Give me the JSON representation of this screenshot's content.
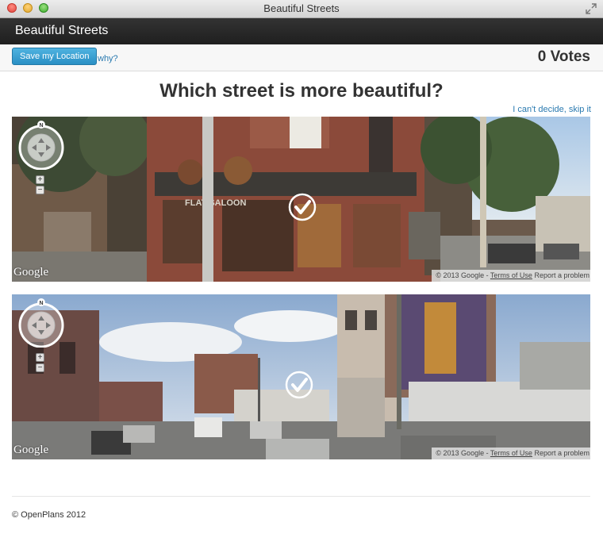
{
  "window": {
    "title": "Beautiful Streets"
  },
  "navbar": {
    "brand": "Beautiful Streets"
  },
  "toolbar": {
    "save_label": "Save my Location",
    "why_label": "why?",
    "votes_count": "0",
    "votes_label": "Votes"
  },
  "main": {
    "question": "Which street is more beautiful?",
    "skip_label": "I can't decide, skip it"
  },
  "panes": [
    {
      "compass_label": "N",
      "zoom_in": "+",
      "zoom_out": "−",
      "logo": "Google",
      "copyright": "© 2013 Google - ",
      "terms": "Terms of Use",
      "report": "Report a problem"
    },
    {
      "compass_label": "N",
      "zoom_in": "+",
      "zoom_out": "−",
      "logo": "Google",
      "copyright": "© 2013 Google - ",
      "terms": "Terms of Use",
      "report": "Report a problem"
    }
  ],
  "footer": {
    "text": "© OpenPlans 2012"
  },
  "colors": {
    "navbar": "#222222",
    "button": "#2f9ad0",
    "link": "#2a7ab0"
  },
  "icons": [
    "fullscreen-icon",
    "compass-icon",
    "check-icon"
  ]
}
